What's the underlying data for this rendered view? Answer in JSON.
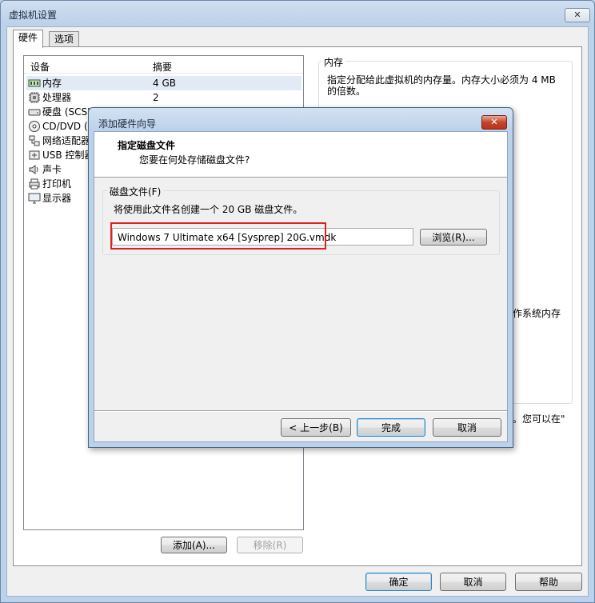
{
  "window": {
    "title": "虚拟机设置",
    "close_glyph": "✕"
  },
  "tabs": [
    {
      "label": "硬件",
      "active": true
    },
    {
      "label": "选项",
      "active": false
    }
  ],
  "device_list": {
    "col_device": "设备",
    "col_summary": "摘要",
    "items": [
      {
        "icon": "memory-icon",
        "name": "内存",
        "summary": "4 GB"
      },
      {
        "icon": "cpu-icon",
        "name": "处理器",
        "summary": "2"
      },
      {
        "icon": "disk-icon",
        "name": "硬盘 (SCSI",
        "summary": ""
      },
      {
        "icon": "cd-icon",
        "name": "CD/DVD (S",
        "summary": ""
      },
      {
        "icon": "network-icon",
        "name": "网络适配器",
        "summary": ""
      },
      {
        "icon": "usb-icon",
        "name": "USB 控制器",
        "summary": ""
      },
      {
        "icon": "speaker-icon",
        "name": "声卡",
        "summary": ""
      },
      {
        "icon": "printer-icon",
        "name": "打印机",
        "summary": ""
      },
      {
        "icon": "monitor-icon",
        "name": "显示器",
        "summary": ""
      }
    ]
  },
  "memory_group": {
    "label": "内存",
    "description_line1": "指定分配给此虚拟机的内存量。内存大小必须为 4 MB",
    "description_line2": "的倍数。",
    "fragment_right1": "作系统内存",
    "fragment_right2": "。您可以在\""
  },
  "list_buttons": {
    "add": "添加(A)...",
    "remove": "移除(R)"
  },
  "footer_buttons": {
    "ok": "确定",
    "cancel": "取消",
    "help": "帮助"
  },
  "wizard": {
    "title": "添加硬件向导",
    "close_glyph": "✕",
    "heading": "指定磁盘文件",
    "subheading": "您要在何处存储磁盘文件?",
    "group_label": "磁盘文件(F)",
    "info": "将使用此文件名创建一个 20 GB 磁盘文件。",
    "filename": "Windows 7 Ultimate x64 [Sysprep] 20G.vmdk",
    "browse": "浏览(R)...",
    "back": "< 上一步(B)",
    "finish": "完成",
    "cancel": "取消"
  }
}
